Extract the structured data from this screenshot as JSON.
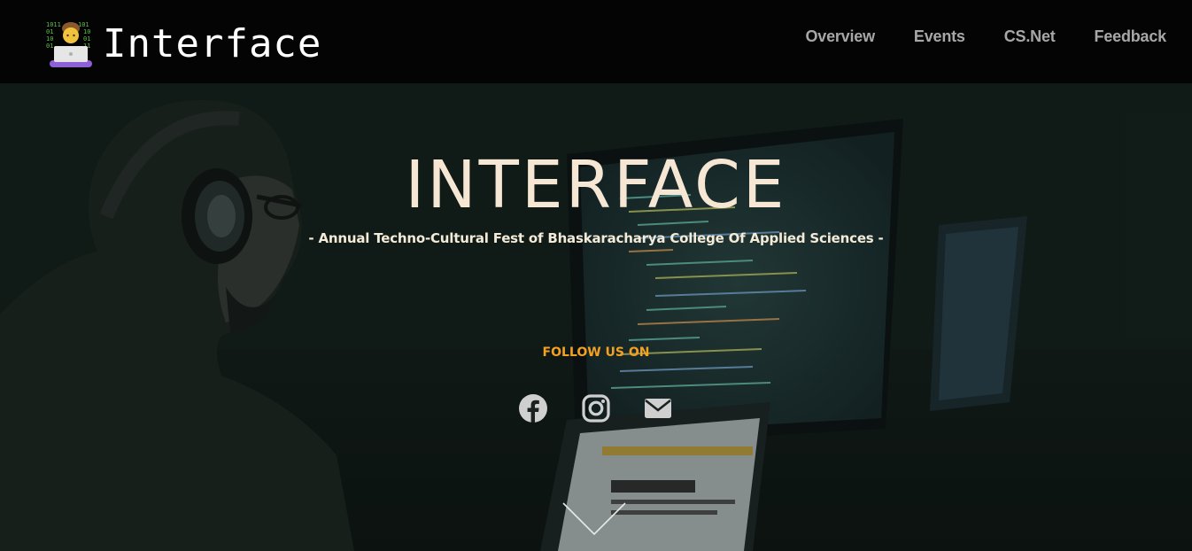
{
  "brand": {
    "name": "Interface",
    "icon": "laptop-coder-icon"
  },
  "nav": {
    "items": [
      {
        "label": "Overview"
      },
      {
        "label": "Events"
      },
      {
        "label": "CS.Net"
      },
      {
        "label": "Feedback"
      }
    ]
  },
  "hero": {
    "title": "INTERFACE",
    "subtitle": "- Annual Techno-Cultural Fest of Bhaskaracharya College Of Applied Sciences -",
    "follow_label": "FOLLOW US ON",
    "socials": [
      {
        "icon": "facebook-icon"
      },
      {
        "icon": "instagram-icon"
      },
      {
        "icon": "mail-icon"
      }
    ],
    "scroll_icon": "chevron-down-icon"
  },
  "colors": {
    "accent": "#f3a122",
    "title": "#f6e6d4",
    "nav_text": "#a7a7a7",
    "navbar_bg": "#040404"
  }
}
